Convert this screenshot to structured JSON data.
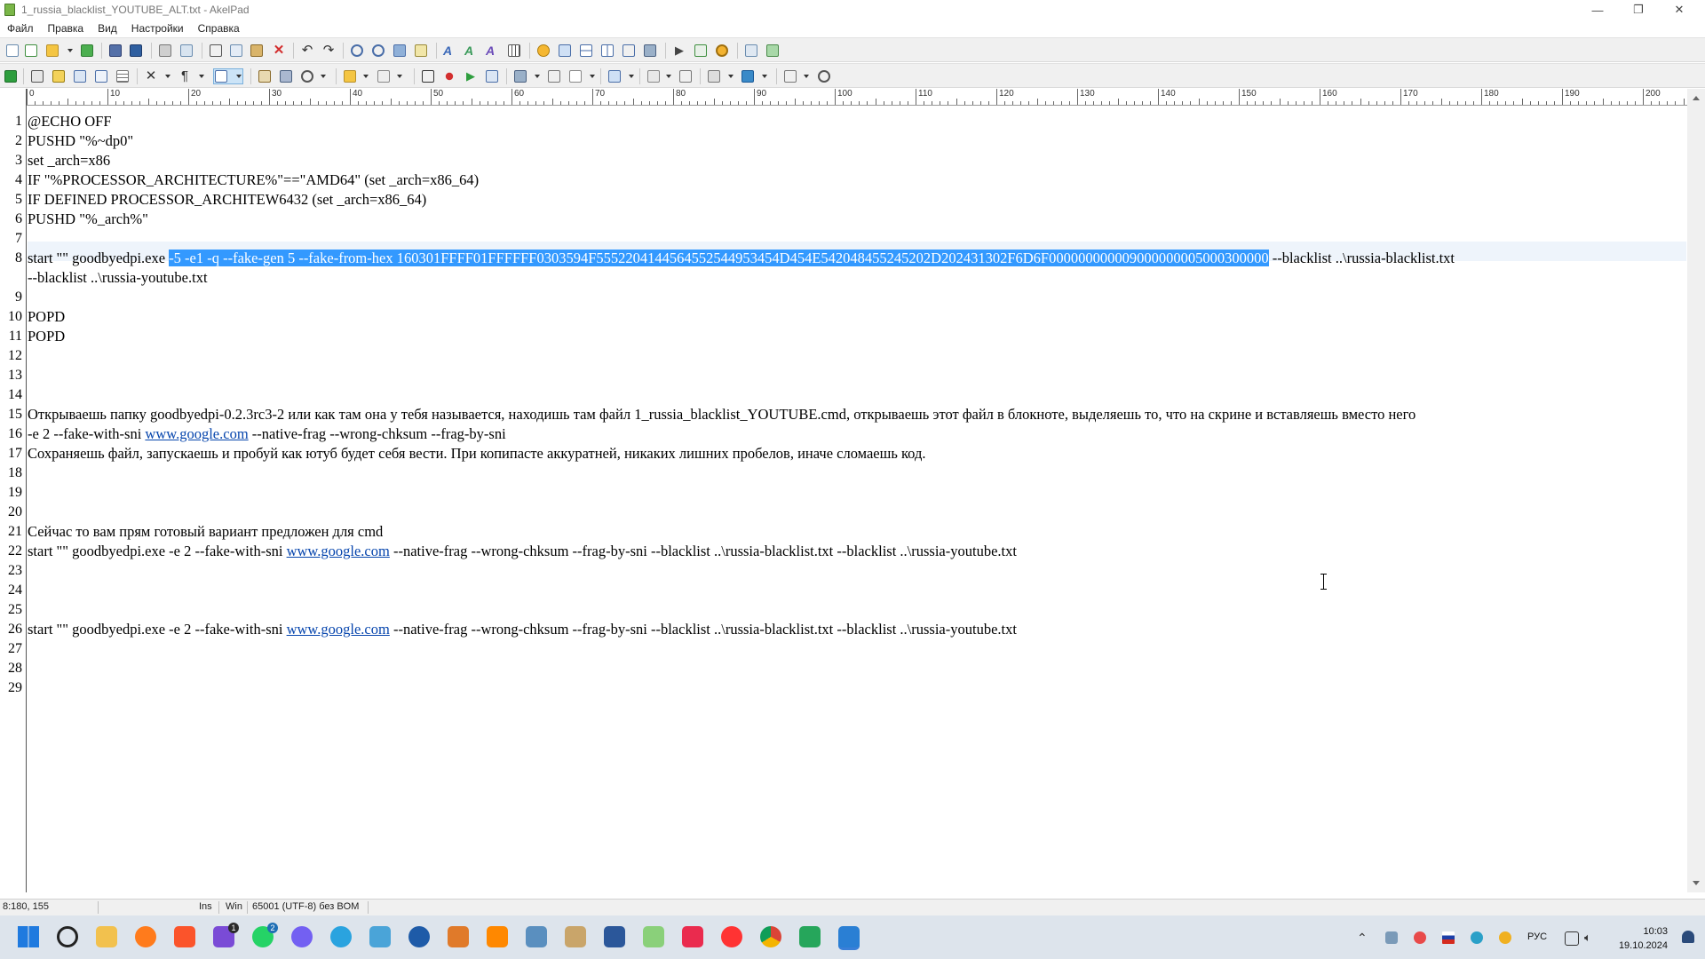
{
  "window": {
    "title": "1_russia_blacklist_YOUTUBE_ALT.txt - AkelPad",
    "minimize_glyph": "—",
    "maximize_glyph": "❐",
    "close_glyph": "✕"
  },
  "menu": {
    "items": [
      "Файл",
      "Правка",
      "Вид",
      "Настройки",
      "Справка"
    ]
  },
  "ruler": {
    "labels": [
      "0",
      "10",
      "20",
      "30",
      "40",
      "50",
      "60",
      "70",
      "80",
      "90",
      "100",
      "110",
      "120",
      "130",
      "140",
      "150",
      "160",
      "170",
      "180",
      "190",
      "200"
    ]
  },
  "editor": {
    "gutter": [
      {
        "n": "1",
        "row": 0
      },
      {
        "n": "2",
        "row": 1
      },
      {
        "n": "3",
        "row": 2
      },
      {
        "n": "4",
        "row": 3
      },
      {
        "n": "5",
        "row": 4
      },
      {
        "n": "6",
        "row": 5
      },
      {
        "n": "7",
        "row": 6
      },
      {
        "n": "8",
        "row": 7
      },
      {
        "n": "9",
        "row": 9
      },
      {
        "n": "10",
        "row": 10
      },
      {
        "n": "11",
        "row": 11
      },
      {
        "n": "12",
        "row": 12
      },
      {
        "n": "13",
        "row": 13
      },
      {
        "n": "14",
        "row": 14
      },
      {
        "n": "15",
        "row": 15
      },
      {
        "n": "16",
        "row": 16
      },
      {
        "n": "17",
        "row": 17
      },
      {
        "n": "18",
        "row": 18
      },
      {
        "n": "19",
        "row": 19
      },
      {
        "n": "20",
        "row": 20
      },
      {
        "n": "21",
        "row": 21
      },
      {
        "n": "22",
        "row": 22
      },
      {
        "n": "23",
        "row": 23
      },
      {
        "n": "24",
        "row": 24
      },
      {
        "n": "25",
        "row": 25
      },
      {
        "n": "26",
        "row": 26
      },
      {
        "n": "27",
        "row": 27
      },
      {
        "n": "28",
        "row": 28
      },
      {
        "n": "29",
        "row": 29
      }
    ],
    "lines": [
      {
        "row": 0,
        "parts": [
          {
            "t": "@ECHO OFF"
          }
        ]
      },
      {
        "row": 1,
        "parts": [
          {
            "t": "PUSHD \"%~dp0\""
          }
        ]
      },
      {
        "row": 2,
        "parts": [
          {
            "t": "set _arch=x86"
          }
        ]
      },
      {
        "row": 3,
        "parts": [
          {
            "t": "IF \"%PROCESSOR_ARCHITECTURE%\"==\"AMD64\" (set _arch=x86_64)"
          }
        ]
      },
      {
        "row": 4,
        "parts": [
          {
            "t": "IF DEFINED PROCESSOR_ARCHITEW6432 (set _arch=x86_64)"
          }
        ]
      },
      {
        "row": 5,
        "parts": [
          {
            "t": "PUSHD \"%_arch%\""
          }
        ]
      },
      {
        "row": 7,
        "parts": [
          {
            "t": "start \"\" goodbyedpi.exe "
          },
          {
            "t": "-5 -e1 -q --fake-gen 5 --fake-from-hex 160301FFFF01FFFFFF0303594F5552204144564552544953454D454E542048455245202D202431302F6D6F000000000009000000005000300000",
            "k": "sel"
          },
          {
            "t": " --blacklist ..\\russia-blacklist.txt"
          }
        ]
      },
      {
        "row": 8,
        "parts": [
          {
            "t": "--blacklist ..\\russia-youtube.txt"
          }
        ]
      },
      {
        "row": 10,
        "parts": [
          {
            "t": "POPD"
          }
        ]
      },
      {
        "row": 11,
        "parts": [
          {
            "t": "POPD"
          }
        ]
      },
      {
        "row": 15,
        "parts": [
          {
            "t": "Открываешь папку goodbyedpi-0.2.3rc3-2 или как там она у тебя называется, находишь там файл 1_russia_blacklist_YOUTUBE.cmd, открываешь этот файл в блокноте, выделяешь то, что на скрине и вставляешь вместо него"
          }
        ]
      },
      {
        "row": 16,
        "parts": [
          {
            "t": "-e 2 --fake-with-sni "
          },
          {
            "t": "www.google.com",
            "k": "link"
          },
          {
            "t": " --native-frag --wrong-chksum --frag-by-sni"
          }
        ]
      },
      {
        "row": 17,
        "parts": [
          {
            "t": "Сохраняешь файл, запускаешь и пробуй как ютуб будет себя вести. При копипасте аккуратней, никаких лишних пробелов, иначе сломаешь код."
          }
        ]
      },
      {
        "row": 21,
        "parts": [
          {
            "t": "Сейчас то вам прям готовый вариант предложен для cmd"
          }
        ]
      },
      {
        "row": 22,
        "parts": [
          {
            "t": "start \"\" goodbyedpi.exe -e 2 --fake-with-sni "
          },
          {
            "t": "www.google.com",
            "k": "link"
          },
          {
            "t": " --native-frag --wrong-chksum --frag-by-sni --blacklist ..\\russia-blacklist.txt --blacklist ..\\russia-youtube.txt"
          }
        ]
      },
      {
        "row": 26,
        "parts": [
          {
            "t": "start \"\" goodbyedpi.exe -e 2 --fake-with-sni "
          },
          {
            "t": "www.google.com",
            "k": "link"
          },
          {
            "t": " --native-frag --wrong-chksum --frag-by-sni --blacklist ..\\russia-blacklist.txt --blacklist ..\\russia-youtube.txt"
          }
        ]
      }
    ]
  },
  "status": {
    "position": "8:180, 155",
    "insert_mode": "Ins",
    "newline": "Win",
    "encoding": "65001 (UTF-8) без BOM"
  },
  "taskbar": {
    "badge_viber": "1",
    "badge_whatsapp": "2",
    "lang": "РУС",
    "time": "10:03",
    "date": "19.10.2024"
  },
  "colors": {
    "selection": "#3399ff",
    "link": "#0645ad",
    "taskbar": "#dde4ec"
  }
}
